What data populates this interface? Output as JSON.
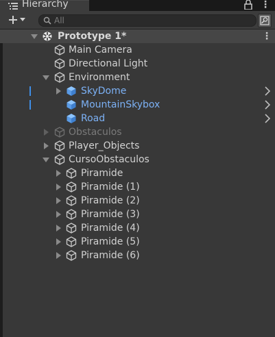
{
  "window": {
    "title": "Hierarchy"
  },
  "toolbar": {
    "search_placeholder": "All"
  },
  "scene": {
    "name": "Prototype 1*"
  },
  "items": [
    {
      "label": "Main Camera"
    },
    {
      "label": "Directional Light"
    },
    {
      "label": "Environment"
    },
    {
      "label": "SkyDome"
    },
    {
      "label": "MountainSkybox"
    },
    {
      "label": "Road"
    },
    {
      "label": "Obstaculos"
    },
    {
      "label": "Player_Objects"
    },
    {
      "label": "CursoObstaculos"
    },
    {
      "label": "Piramide"
    },
    {
      "label": "Piramide (1)"
    },
    {
      "label": "Piramide (2)"
    },
    {
      "label": "Piramide (3)"
    },
    {
      "label": "Piramide (4)"
    },
    {
      "label": "Piramide (5)"
    },
    {
      "label": "Piramide (6)"
    }
  ],
  "colors": {
    "prefab": "#7cb1f5",
    "inactive": "#7a7a7a",
    "selection_bar": "#3f8ee6"
  }
}
